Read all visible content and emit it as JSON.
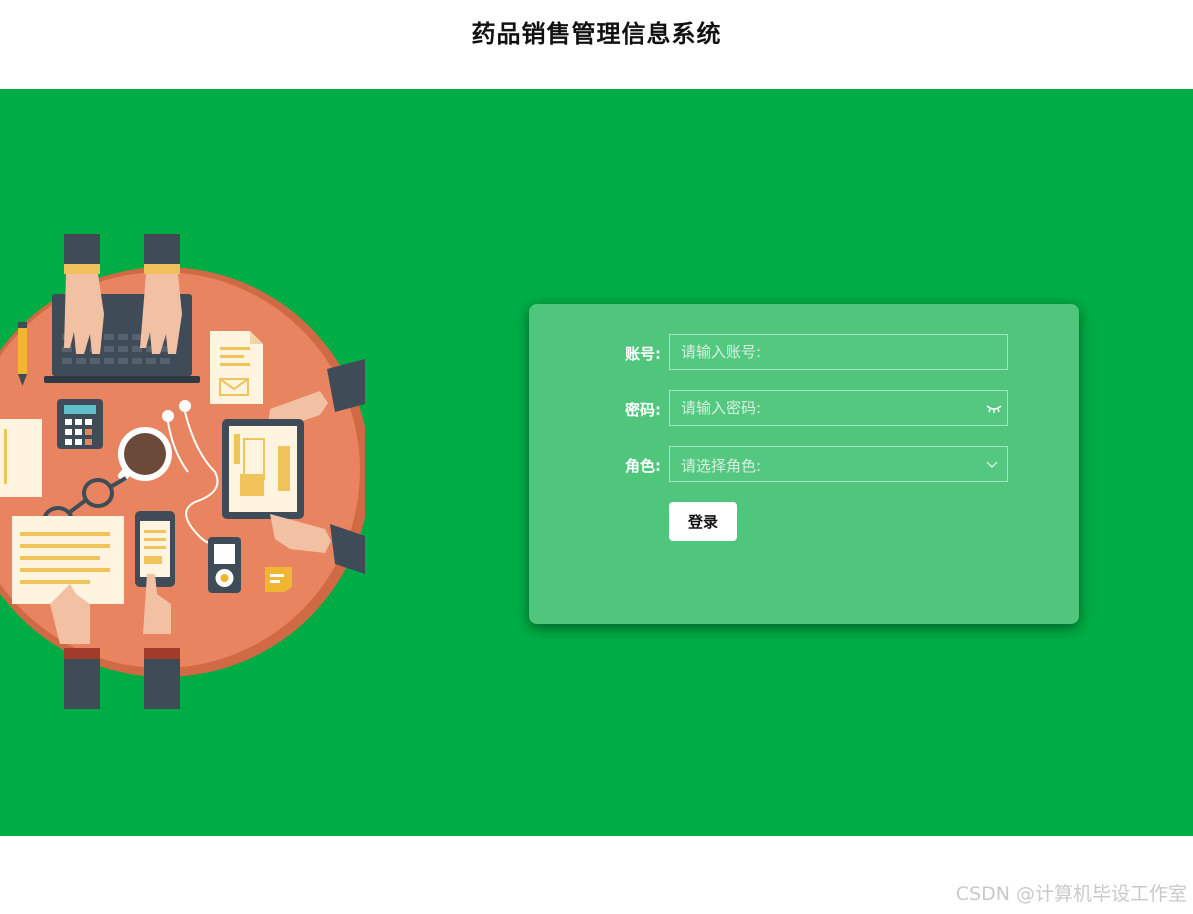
{
  "header": {
    "title": "药品销售管理信息系统"
  },
  "form": {
    "account": {
      "label": "账号:",
      "placeholder": "请输入账号:",
      "value": ""
    },
    "password": {
      "label": "密码:",
      "placeholder": "请输入密码:",
      "value": "",
      "toggle_icon": "eye-closed-icon"
    },
    "role": {
      "label": "角色:",
      "placeholder": "请选择角色:",
      "selected": "",
      "dropdown_icon": "chevron-down-icon"
    },
    "login_label": "登录"
  },
  "watermark": "CSDN @计算机毕设工作室",
  "colors": {
    "background": "#00ad45",
    "panel": "#4fc67b",
    "button": "#ffffff"
  }
}
